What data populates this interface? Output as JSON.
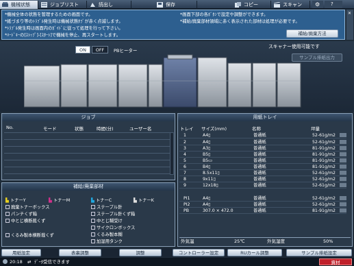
{
  "tabs": [
    {
      "label": "機械状態",
      "icon": "machine-status-icon"
    },
    {
      "label": "ジョブリスト",
      "icon": "job-list-icon"
    },
    {
      "label": "読出し",
      "icon": "recall-icon"
    },
    {
      "label": "保存",
      "icon": "save-icon"
    },
    {
      "label": "コピー",
      "icon": "copy-icon"
    },
    {
      "label": "スキャン",
      "icon": "scan-icon"
    }
  ],
  "messages": {
    "m1": "*機械全体の状態を管理するための画面です。",
    "m2": "*紙づまり等のﾄﾗﾌﾞﾙ発生時は機械状態ﾀﾌﾞが赤く点滅します。",
    "m3": "*ﾄﾗﾌﾞﾙ発生時は画面内のｶﾞｲﾄﾞに従って処理を行って下さい。",
    "m4": "*ﾊｰﾄﾞｷｰの[ｽﾄｯﾌﾟ]-[ｽﾀｰﾄ]で機械を停止、再スタートします。",
    "m5": "*画面下部の各ﾎﾞﾀﾝで設定や調整ができます。",
    "m6": "*補給/廃棄部材領域に赤く表示された部材は処理が必要です。",
    "supply_button": "補給/廃棄方法"
  },
  "machine": {
    "on_label": "ON",
    "off_label": "OFF",
    "heater_label": "PBヒーター",
    "scanner_status": "スキャナー使用可能です",
    "sample_button": "サンプル排紙出力"
  },
  "job": {
    "title": "ジョブ",
    "columns": [
      "No.",
      "モード",
      "状態",
      "時間(分)",
      "ユーザー名"
    ]
  },
  "tray": {
    "title": "用紙トレイ",
    "columns": [
      "トレイ",
      "サイズ(mm)",
      "名称",
      "坪量"
    ],
    "rows": [
      {
        "tray": "1",
        "size": "A4▯",
        "name": "普通紙",
        "weight": "52-61g/m2"
      },
      {
        "tray": "2",
        "size": "A4▯",
        "name": "普通紙",
        "weight": "52-61g/m2"
      },
      {
        "tray": "3",
        "size": "A3▯",
        "name": "普通紙",
        "weight": "81-91g/m2"
      },
      {
        "tray": "4",
        "size": "B5▯",
        "name": "普通紙",
        "weight": "81-91g/m2"
      },
      {
        "tray": "5",
        "size": "B5▭",
        "name": "普通紙",
        "weight": "81-91g/m2"
      },
      {
        "tray": "6",
        "size": "B4▯",
        "name": "普通紙",
        "weight": "81-91g/m2"
      },
      {
        "tray": "7",
        "size": "8.5x11▯",
        "name": "普通紙",
        "weight": "52-61g/m2"
      },
      {
        "tray": "8",
        "size": "9x11▯",
        "name": "普通紙",
        "weight": "52-61g/m2"
      },
      {
        "tray": "9",
        "size": "12x18▯",
        "name": "普通紙",
        "weight": "52-61g/m2"
      },
      {
        "tray": "PI1",
        "size": "A4▯",
        "name": "普通紙",
        "weight": "52-61g/m2"
      },
      {
        "tray": "PI2",
        "size": "A4▯",
        "name": "普通紙",
        "weight": "52-61g/m2"
      },
      {
        "tray": "PB",
        "size": "307.0 × 472.0",
        "name": "普通紙",
        "weight": "81-91g/m2"
      }
    ],
    "outside_temp_label": "外気温",
    "outside_temp_value": "25℃",
    "outside_humidity_label": "外気湿度",
    "outside_humidity_value": "50%"
  },
  "supply": {
    "title": "補給/廃棄部材",
    "toners": [
      "トナーY",
      "トナーM",
      "トナーC",
      "トナーK"
    ],
    "left_items": [
      "廃棄トナーボックス",
      "パンチくず箱",
      "中とじ横断裁くず",
      "",
      "くるみ製本横断裁くず"
    ],
    "right_items": [
      "ステープル針",
      "ステープル針くず箱",
      "中とじ糊受け",
      "サイクロンボックス",
      "くるみ製本糊",
      "加湿用タンク"
    ]
  },
  "bottom_buttons": [
    "用紙設定",
    "表裏調整",
    "調整",
    "コントローラー設定",
    "RUカール調整",
    "サンプル排紙設定"
  ],
  "status": {
    "time": "20:18",
    "message": "ﾃﾞｰﾀ受信できます",
    "material_label": "資材"
  },
  "colors": {
    "tab_active": "#c6d4e4",
    "message_bg": "#2d5f8f",
    "panel_bg": "#2a3949",
    "accent_red": "#c0202a"
  }
}
